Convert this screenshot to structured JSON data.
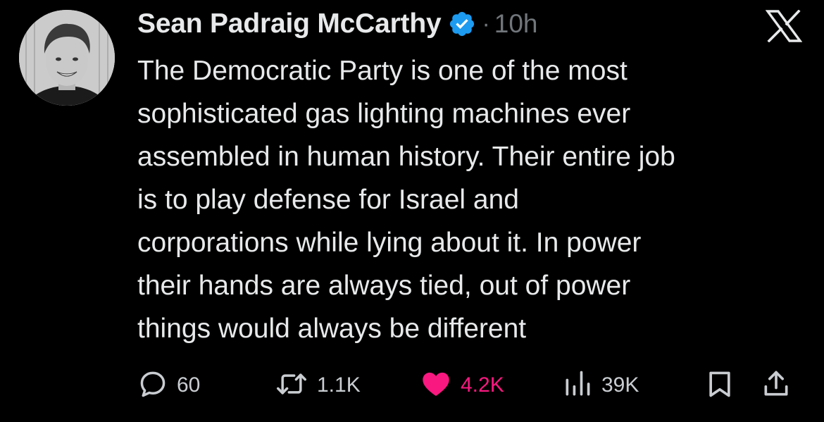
{
  "tweet": {
    "author_name": "Sean Padraig McCarthy",
    "separator": "·",
    "time": "10h",
    "body_lines": [
      "The Democratic Party is one of the most",
      "sophisticated gas lighting machines ever",
      "assembled in human history. Their entire job",
      "is to play defense for Israel and",
      "corporations while lying about it. In power",
      "their hands are always tied, out of power",
      "things would always be different"
    ]
  },
  "actions": {
    "replies": "60",
    "reposts": "1.1K",
    "likes": "4.2K",
    "views": "39K"
  },
  "icons": {
    "verified": "verified-badge-icon",
    "logo": "x-logo-icon",
    "reply": "reply-icon",
    "repost": "repost-icon",
    "like": "heart-icon",
    "views": "views-icon",
    "bookmark": "bookmark-icon",
    "share": "share-icon"
  },
  "colors": {
    "background": "#000000",
    "text": "#e7e9ea",
    "muted": "#71767b",
    "verified": "#1d9bf0",
    "like": "#f91880"
  }
}
